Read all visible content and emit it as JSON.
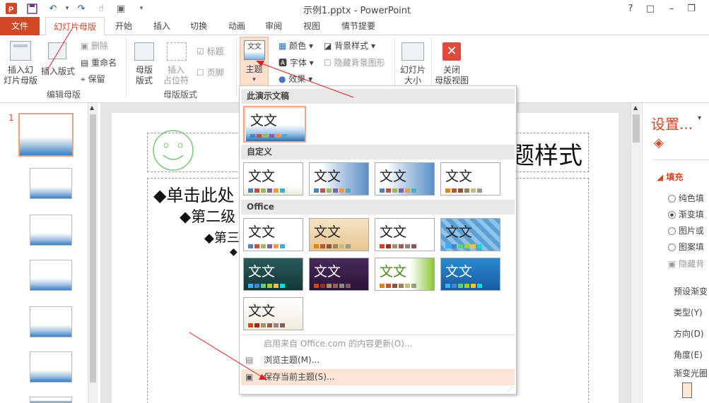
{
  "window": {
    "title": "示例1.pptx - PowerPoint",
    "controls": [
      "?",
      "□",
      "–",
      "❐"
    ]
  },
  "tabs": [
    "文件",
    "幻灯片母版",
    "开始",
    "插入",
    "切换",
    "动画",
    "审阅",
    "视图",
    "情节提要"
  ],
  "ribbon": {
    "insert_master": "插入幻\n灯片母版",
    "insert_layout": "插入版式",
    "delete": "删除",
    "rename": "重命名",
    "preserve": "保留",
    "group_edit_master": "编辑母版",
    "master_layout": "母版\n版式",
    "insert_placeholder": "插入\n占位符",
    "title_cb": "标题",
    "footer_cb": "页脚",
    "group_master_layout": "母版版式",
    "themes": "主题",
    "colors": "颜色",
    "fonts": "字体",
    "effects": "效果",
    "bg_styles": "背景样式",
    "hide_bg": "隐藏背景图形",
    "slide_size": "幻灯片\n大小",
    "close_master": "关闭\n母版视图"
  },
  "slide": {
    "title_fragment": "题样式",
    "bullet1": "◆单击此处",
    "bullet2": "◆第二级",
    "bullet3": "◆第三"
  },
  "thumb_number": "1",
  "menu": {
    "sec_current": "此演示文稿",
    "sec_custom": "自定义",
    "sec_office": "Office",
    "tile_text": "文文",
    "enable_updates": "启用来自 Office.com 的内容更新(O)...",
    "browse": "浏览主题(M)...",
    "save": "保存当前主题(S)..."
  },
  "right_pane": {
    "title": "设置...",
    "fill": "填充",
    "options": [
      "纯色填",
      "渐变填",
      "图片或",
      "图案填",
      "隐藏背"
    ],
    "preset": "预设渐变",
    "type": "类型(Y)",
    "direction": "方向(D)",
    "angle": "角度(E)",
    "stops": "渐变光圈"
  },
  "colors": {
    "accent": "#d24726",
    "ribbon_highlight": "#fcdfcd",
    "selected_item": "#fce4d6"
  }
}
